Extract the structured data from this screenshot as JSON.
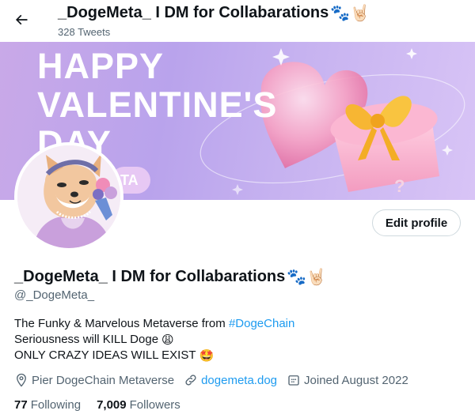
{
  "header": {
    "title": "_DogeMeta_ I DM for Collabarations",
    "title_emoji": "🐾🤘🏻",
    "tweet_count": "328 Tweets"
  },
  "banner": {
    "line1": "HAPPY",
    "line2": "VALENTINE'S",
    "line3": "DAY",
    "pill_text": "TA"
  },
  "profile": {
    "edit_label": "Edit profile",
    "display_name": "_DogeMeta_ I DM for Collabarations",
    "name_emoji": "🐾🤘🏻",
    "handle": "@_DogeMeta_"
  },
  "bio": {
    "line1_text": "The Funky & Marvelous Metaverse from ",
    "line1_hashtag": "#DogeChain",
    "line2_text": "Seriousness will KILL Doge",
    "line2_emoji": "😩",
    "line3_text": "ONLY CRAZY IDEAS WILL EXIST",
    "line3_emoji": "🤩"
  },
  "meta": {
    "location": "Pier DogeChain Metaverse",
    "website": "dogemeta.dog",
    "joined": "Joined August 2022"
  },
  "follow": {
    "following_count": "77",
    "following_label": "Following",
    "followers_count": "7,009",
    "followers_label": "Followers"
  },
  "colors": {
    "accent": "#1d9bf0",
    "secondary_text": "#536471",
    "primary_text": "#0f1419"
  }
}
